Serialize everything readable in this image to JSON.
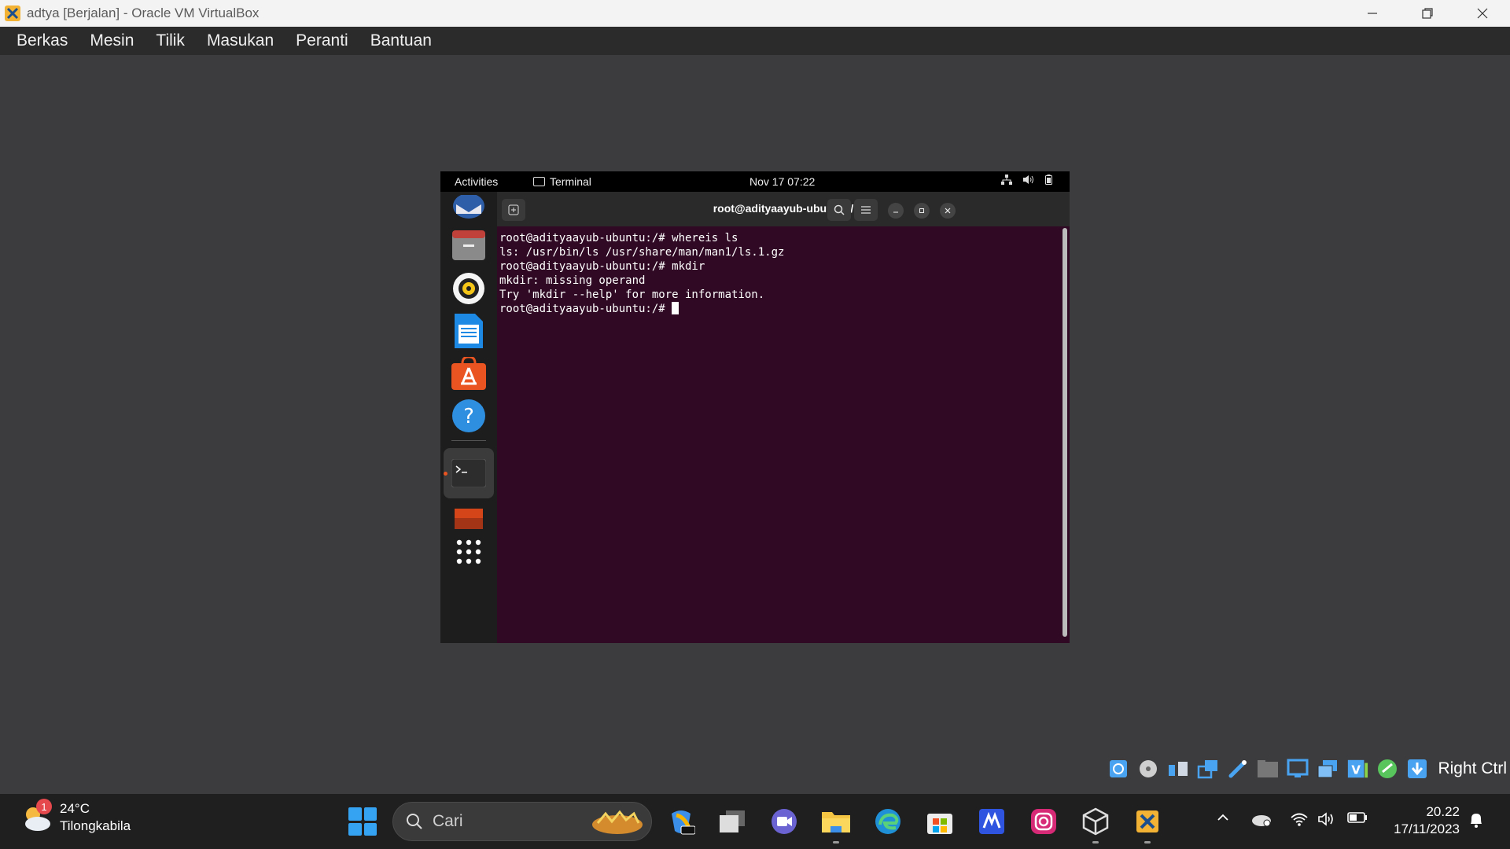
{
  "window": {
    "title": "adtya [Berjalan] - Oracle VM VirtualBox",
    "minimize_icon": "minimize-icon",
    "restore_icon": "restore-icon",
    "close_icon": "close-icon"
  },
  "menu": {
    "items": [
      "Berkas",
      "Mesin",
      "Tilik",
      "Masukan",
      "Peranti",
      "Bantuan"
    ]
  },
  "guest": {
    "topbar": {
      "activities": "Activities",
      "app": "Terminal",
      "clock": "Nov 17  07:22"
    },
    "dock": [
      "thunderbird-icon",
      "files-icon",
      "rhythmbox-icon",
      "writer-icon",
      "app-center-icon",
      "help-icon",
      "terminal-icon",
      "ubuntu-icon",
      "show-apps-icon"
    ],
    "terminal": {
      "title": "root@adityaayub-ubuntu: /",
      "lines": [
        "root@adityaayub-ubuntu:/# whereis ls",
        "ls: /usr/bin/ls /usr/share/man/man1/ls.1.gz",
        "root@adityaayub-ubuntu:/# mkdir",
        "mkdir: missing operand",
        "Try 'mkdir --help' for more information."
      ],
      "prompt": "root@adityaayub-ubuntu:/# "
    }
  },
  "vbox_status": {
    "host_key": "Right Ctrl"
  },
  "taskbar": {
    "weather": {
      "temp": "24°C",
      "location": "Tilongkabila",
      "badge": "1"
    },
    "search_label": "Cari",
    "clock": {
      "time": "20.22",
      "date": "17/11/2023"
    }
  },
  "colors": {
    "terminal_bg": "#300a24",
    "ubuntu_orange": "#e95420",
    "windows_blue": "#35a3f2"
  }
}
